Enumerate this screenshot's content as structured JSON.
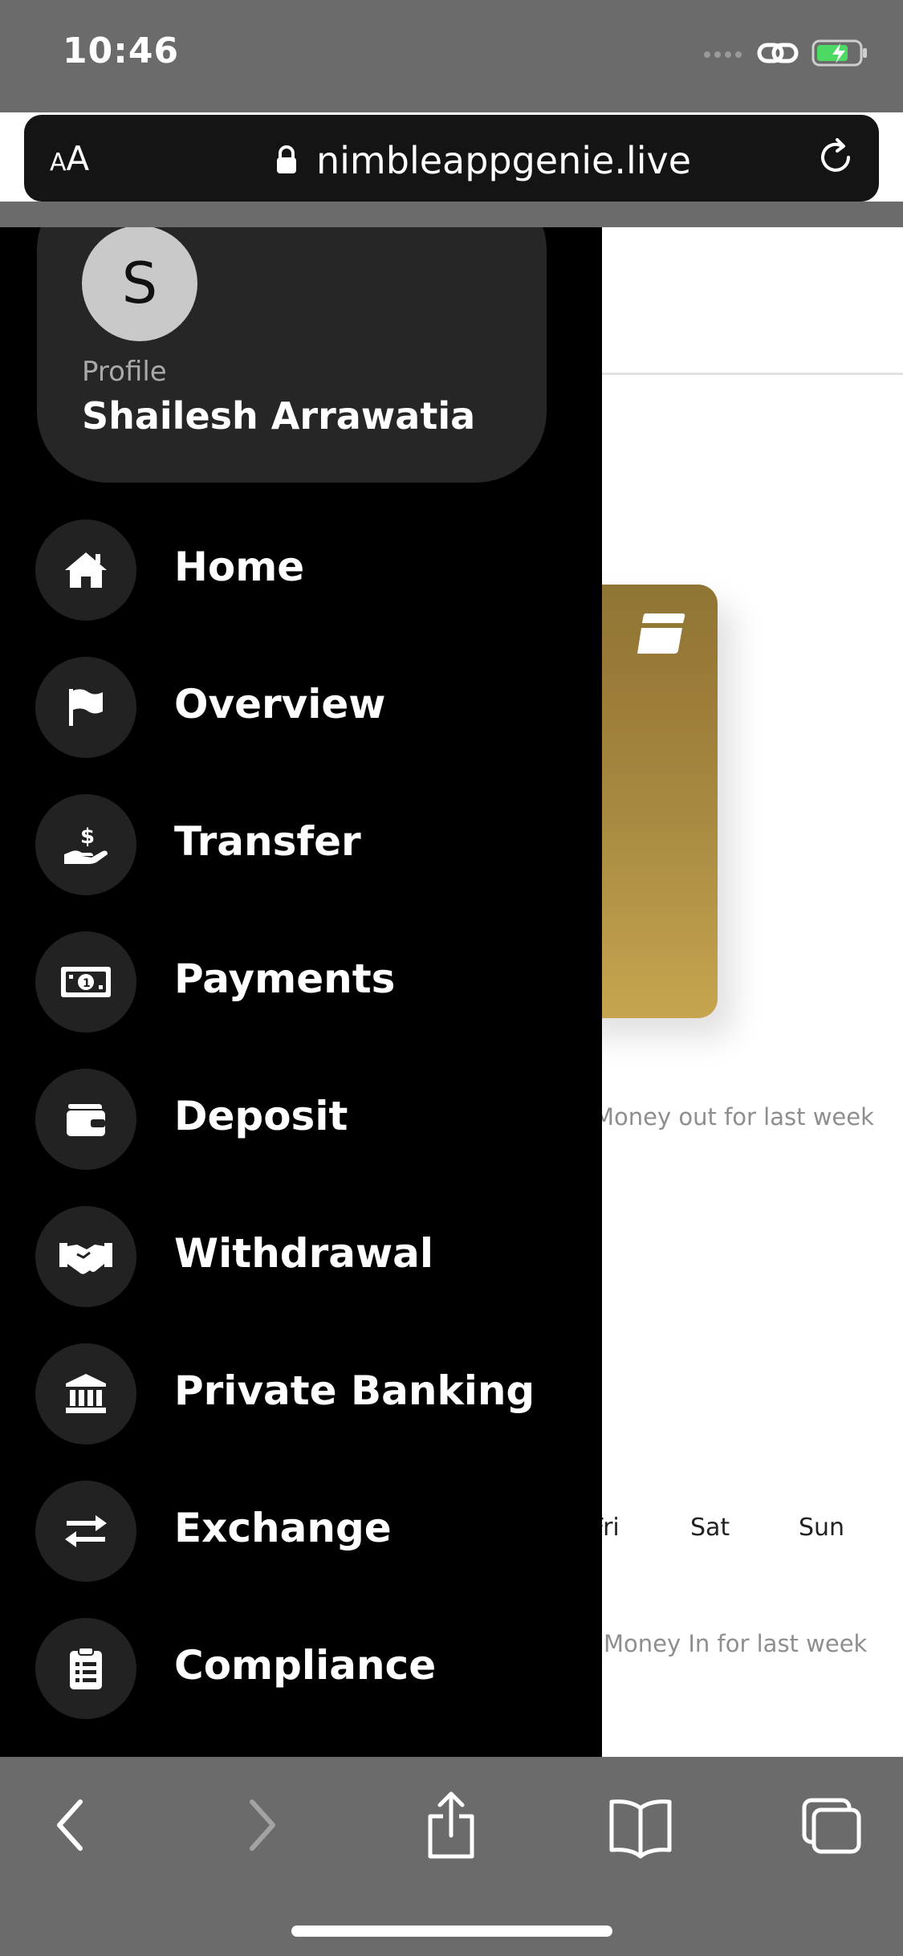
{
  "status": {
    "time": "10:46"
  },
  "browser": {
    "text_size": "AA",
    "url": "nimbleappgenie.live"
  },
  "profile": {
    "initial": "S",
    "label": "Profile",
    "name": "Shailesh Arrawatia"
  },
  "menu": [
    {
      "label": "Home",
      "icon": "home-icon"
    },
    {
      "label": "Overview",
      "icon": "flag-icon"
    },
    {
      "label": "Transfer",
      "icon": "hand-dollar-icon"
    },
    {
      "label": "Payments",
      "icon": "banknote-icon"
    },
    {
      "label": "Deposit",
      "icon": "wallet-icon"
    },
    {
      "label": "Withdrawal",
      "icon": "handshake-icon"
    },
    {
      "label": "Private Banking",
      "icon": "bank-icon"
    },
    {
      "label": "Exchange",
      "icon": "exchange-arrows-icon"
    },
    {
      "label": "Compliance",
      "icon": "clipboard-icon"
    }
  ],
  "page": {
    "money_out": "Money out for last week",
    "money_in": "Money In for last week",
    "days": [
      "Fri",
      "Sat",
      "Sun"
    ]
  },
  "colors": {
    "drawer": "#000000",
    "card_gold": "#a88b42",
    "chrome": "#6b6b6b"
  }
}
